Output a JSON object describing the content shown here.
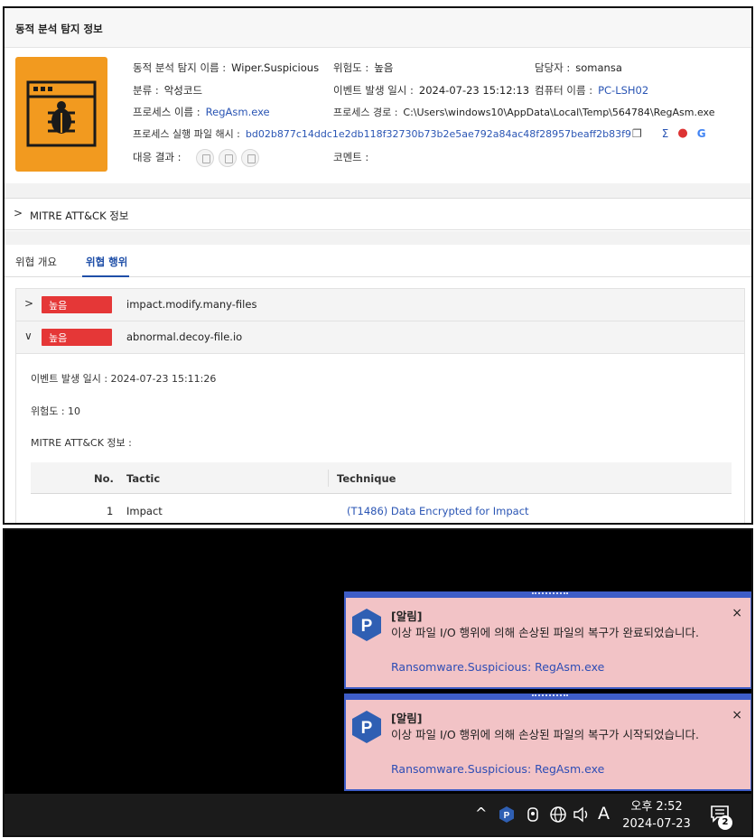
{
  "panel": {
    "title": "동적 분석 탐지 정보",
    "fields": {
      "detect_name_k": "동적 분석 탐지 이름 :",
      "detect_name_v": "Wiper.Suspicious",
      "risk_k": "위험도 :",
      "risk_v": "높음",
      "owner_k": "담당자 :",
      "owner_v": "somansa",
      "category_k": "분류 :",
      "category_v": "악성코드",
      "event_time_k": "이벤트 발생 일시 :",
      "event_time_v": "2024-07-23 15:12:13",
      "computer_k": "컴퓨터 이름 :",
      "computer_v": "PC-LSH02",
      "process_k": "프로세스 이름 :",
      "process_v": "RegAsm.exe",
      "path_k": "프로세스 경로 :",
      "path_v": "C:\\Users\\windows10\\AppData\\Local\\Temp\\564784\\RegAsm.exe",
      "hash_k": "프로세스 실행 파일 해시 :",
      "hash_v": "bd02b877c14ddc1e2db118f32730b73b2e5ae792a84ac48f28957beaff2b83f9",
      "response_k": "대응 결과 :",
      "comment_k": "코멘트 :"
    },
    "mitre_section": "MITRE ATT&CK 정보",
    "tabs": [
      "위협 개요",
      "위협 행위"
    ],
    "threats": [
      {
        "level": "높음",
        "name": "impact.modify.many-files"
      },
      {
        "level": "높음",
        "name": "abnormal.decoy-file.io"
      }
    ],
    "detail": {
      "event_time": "이벤트 발생 일시 : 2024-07-23 15:11:26",
      "risk": "위험도 : 10",
      "mitre_label": "MITRE ATT&CK 정보 :",
      "headers": {
        "no": "No.",
        "tactic": "Tactic",
        "technique": "Technique"
      },
      "row": {
        "no": "1",
        "tactic": "Impact",
        "technique": "(T1486) Data Encrypted for Impact"
      }
    }
  },
  "toasts": [
    {
      "title": "[알림]",
      "message": "이상 파일 I/O 행위에 의해 손상된 파일의 복구가 완료되었습니다.",
      "source": "Ransomware.Suspicious: RegAsm.exe",
      "close": "×"
    },
    {
      "title": "[알림]",
      "message": "이상 파일 I/O 행위에 의해 손상된 파일의 복구가 시작되었습니다.",
      "source": "Ransomware.Suspicious: RegAsm.exe",
      "close": "×"
    }
  ],
  "taskbar": {
    "time": "오후 2:52",
    "date": "2024-07-23",
    "ime": "A",
    "chevron": "^",
    "notification_count": "2"
  },
  "colors": {
    "badge": "#e53737",
    "link": "#2a55b4",
    "toast_bg": "#f2c3c6",
    "toast_border": "#3e5dc7",
    "bug_bg": "#f29a1f"
  }
}
